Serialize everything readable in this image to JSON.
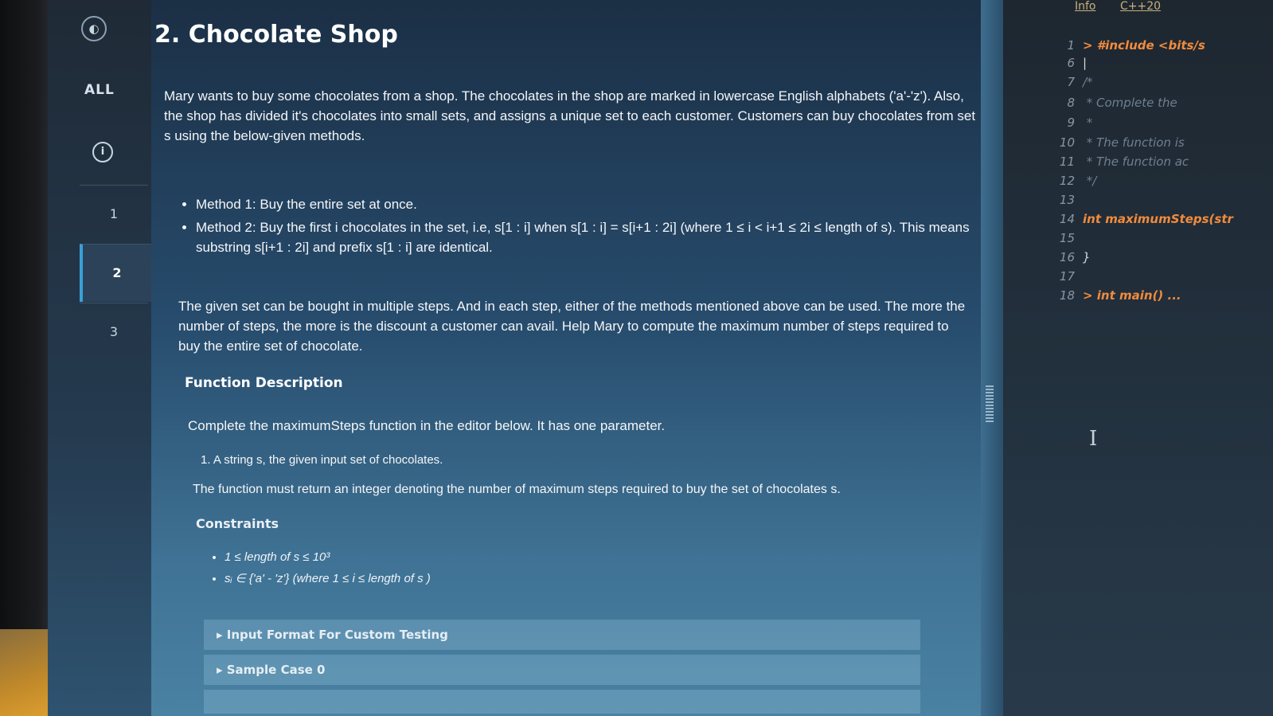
{
  "nav": {
    "all_label": "ALL",
    "items": [
      {
        "label": "1"
      },
      {
        "label": "2"
      },
      {
        "label": "3"
      }
    ]
  },
  "problem": {
    "title": "2. Chocolate Shop",
    "intro": "Mary wants to buy some chocolates from a shop. The chocolates in the shop are marked in lowercase English alphabets ('a'-'z'). Also, the shop has divided it's chocolates into small sets, and assigns a unique set to each customer. Customers can buy chocolates from set s using the below-given methods.",
    "methods": [
      "Method 1: Buy the entire set at once.",
      "Method 2: Buy the first i chocolates in the set, i.e, s[1 : i] when s[1 : i] = s[i+1 : 2i] (where 1 ≤ i < i+1 ≤ 2i ≤ length of s). This means substring s[i+1 : 2i] and prefix s[1 : i] are identical."
    ],
    "steps_text": "The given set can be bought in multiple steps. And in each step, either of the methods mentioned above can be used. The more the number of steps, the more is the discount a customer can avail. Help Mary to compute the maximum number of steps required to buy the entire set of chocolate.",
    "function_heading": "Function Description",
    "function_line": "Complete the maximumSteps function in the editor below. It has one parameter.",
    "param": "1. A string s, the given input set of chocolates.",
    "returns": "The function must return an integer denoting the number of maximum steps required to buy the set of chocolates s.",
    "constraints_heading": "Constraints",
    "constraints": [
      "1 ≤ length of s ≤ 10³",
      "sᵢ ∈ {'a' - 'z'} (where 1 ≤ i ≤ length of s )"
    ],
    "accordions": [
      "▸ Input Format For Custom Testing",
      "▸ Sample Case 0"
    ]
  },
  "editor": {
    "top_links": [
      "Info",
      "C++20"
    ],
    "lines": [
      {
        "num": "1",
        "text": "> #include <bits/s"
      },
      {
        "num": "6",
        "text": "|"
      },
      {
        "num": "7",
        "text": "/*"
      },
      {
        "num": "8",
        "text": " * Complete the"
      },
      {
        "num": "9",
        "text": " *"
      },
      {
        "num": "10",
        "text": " * The function is"
      },
      {
        "num": "11",
        "text": " * The function ac"
      },
      {
        "num": "12",
        "text": " */"
      },
      {
        "num": "13",
        "text": ""
      },
      {
        "num": "14",
        "text": "int maximumSteps(str"
      },
      {
        "num": "15",
        "text": ""
      },
      {
        "num": "16",
        "text": "}"
      },
      {
        "num": "17",
        "text": ""
      },
      {
        "num": "18",
        "text": "> int main() ..."
      }
    ]
  }
}
